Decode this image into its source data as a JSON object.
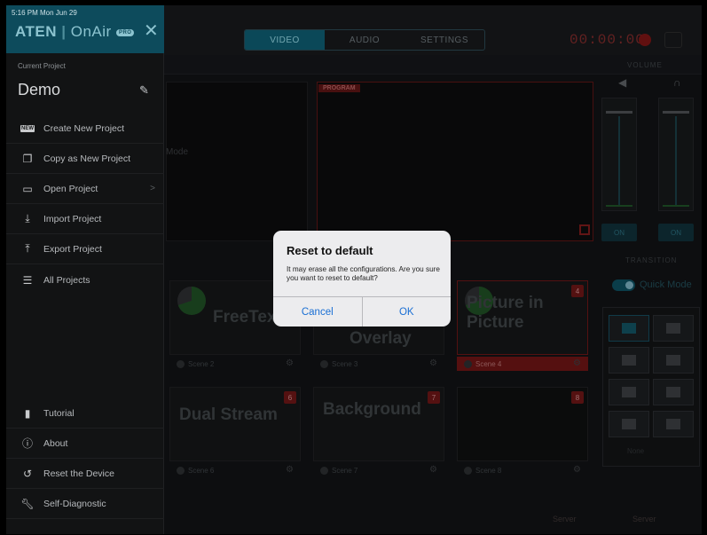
{
  "status": {
    "time": "5:16 PM  Mon Jun 29"
  },
  "brand": {
    "name": "ATEN",
    "product": "OnAir",
    "edition": "PRO"
  },
  "panel": {
    "current_project_label": "Current Project",
    "project_name": "Demo",
    "menu": [
      {
        "label": "Create New Project",
        "icon": "new-project-icon"
      },
      {
        "label": "Copy as New Project",
        "icon": "copy-icon"
      },
      {
        "label": "Open Project",
        "icon": "folder-icon"
      },
      {
        "label": "Import Project",
        "icon": "import-icon"
      },
      {
        "label": "Export Project",
        "icon": "export-icon"
      },
      {
        "label": "All Projects",
        "icon": "clipboard-icon"
      }
    ],
    "footer_menu": [
      {
        "label": "Tutorial",
        "icon": "book-icon"
      },
      {
        "label": "About",
        "icon": "info-icon"
      },
      {
        "label": "Reset the Device",
        "icon": "reset-icon"
      },
      {
        "label": "Self-Diagnostic",
        "icon": "wrench-icon"
      }
    ]
  },
  "background": {
    "tabs": [
      "VIDEO",
      "AUDIO",
      "SETTINGS"
    ],
    "timer": "00:00:00",
    "volume_label": "VOLUME",
    "preview_text": "Mode",
    "program_label": "PROGRAM",
    "on_labels": [
      "ON",
      "ON"
    ],
    "transition_label": "TRANSITION",
    "quick_mode_label": "Quick Mode",
    "none_label": "None",
    "scenes": [
      {
        "title": "FreeText",
        "caption": "Scene 2"
      },
      {
        "title": "Overlay",
        "caption": "Scene 3"
      },
      {
        "title": "Picture in Picture",
        "caption": "Scene 4",
        "badge": "4"
      },
      {
        "title": "Dual Stream",
        "caption": "Scene 6",
        "badge": "6"
      },
      {
        "title": "Background",
        "caption": "Scene 7",
        "badge": "7"
      },
      {
        "title": "",
        "caption": "Scene 8",
        "badge": "8"
      }
    ],
    "bottom": [
      "Server",
      "Server"
    ]
  },
  "dialog": {
    "title": "Reset to default",
    "message": "It may erase all the configurations. Are you sure you want to reset to default?",
    "cancel": "Cancel",
    "ok": "OK"
  },
  "colors": {
    "panel_header": "#0d4b5c",
    "dialog_button": "#1a6fd4",
    "program_border": "#5a1414"
  }
}
